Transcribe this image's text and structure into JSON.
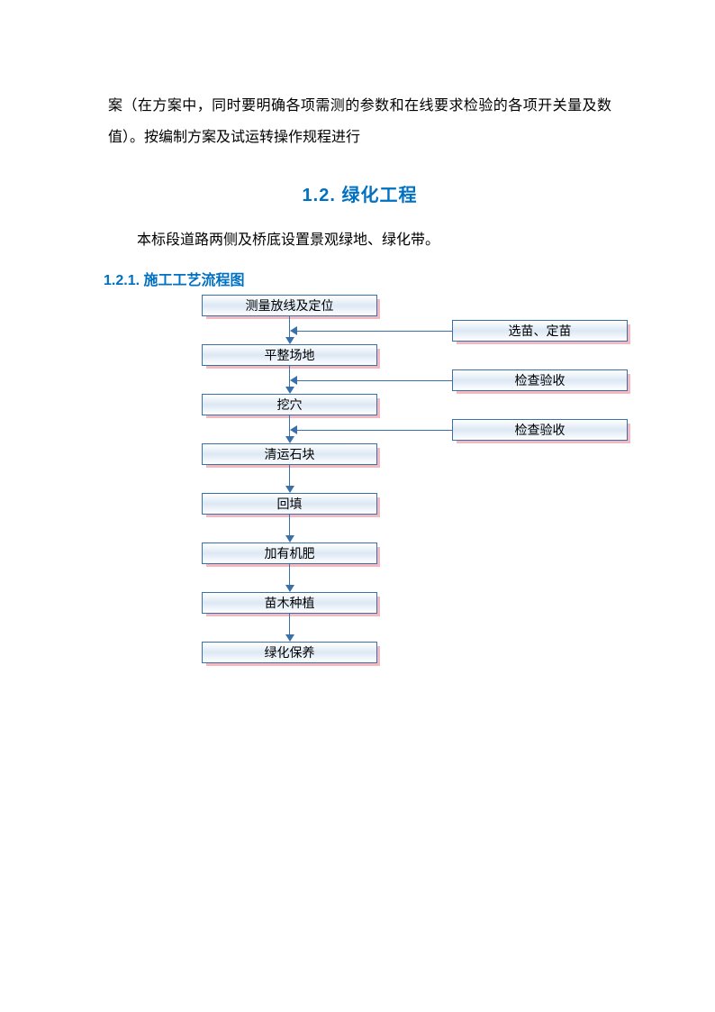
{
  "para1": "案（在方案中，同时要明确各项需测的参数和在线要求检验的各项开关量及数值）。按编制方案及试运转操作规程进行",
  "heading": "1.2. 绿化工程",
  "para2": "本标段道路两侧及桥底设置景观绿地、绿化带。",
  "subheading": "1.2.1. 施工工艺流程图",
  "flow": {
    "left": [
      "测量放线及定位",
      "平整场地",
      "挖穴",
      "清运石块",
      "回填",
      "加有机肥",
      "苗木种植",
      "绿化保养"
    ],
    "right": [
      "选苗、定苗",
      "检查验收",
      "检查验收"
    ]
  }
}
